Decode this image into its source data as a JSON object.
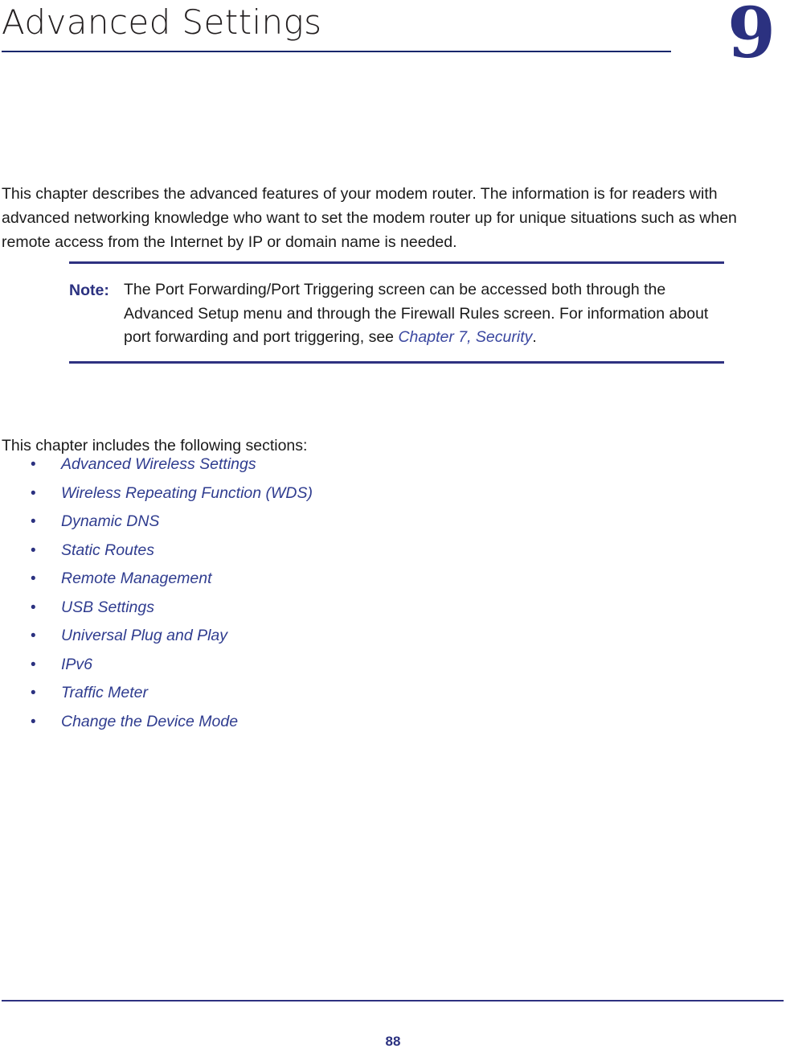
{
  "chapter": {
    "title": "Advanced Settings",
    "number": "9"
  },
  "intro": {
    "paragraph": "This chapter describes the advanced features of your modem router. The information is for readers with advanced networking knowledge who want to set the modem router up for unique situations such as when remote access from the Internet by IP or domain name is needed."
  },
  "note": {
    "label": "Note:",
    "text_before_link": "The Port Forwarding/Port Triggering screen can be accessed both through the Advanced Setup menu and through the Firewall Rules screen. For information about port forwarding and port triggering, see ",
    "link_text": "Chapter 7, Security",
    "text_after_link": "."
  },
  "sections": {
    "intro": "This chapter includes the following sections:",
    "bullet_glyph": "•",
    "items": [
      {
        "label": "Advanced Wireless Settings"
      },
      {
        "label": "Wireless Repeating Function (WDS)"
      },
      {
        "label": "Dynamic DNS"
      },
      {
        "label": "Static Routes"
      },
      {
        "label": "Remote Management"
      },
      {
        "label": "USB Settings"
      },
      {
        "label": "Universal Plug and Play"
      },
      {
        "label": "IPv6"
      },
      {
        "label": "Traffic Meter"
      },
      {
        "label": "Change the Device Mode"
      }
    ]
  },
  "footer": {
    "page_number": "88"
  },
  "colors": {
    "navy_rule": "#2e3180",
    "title_rule": "#16266b",
    "chapter_number": "#2b3180",
    "link": "#2f3c8f",
    "note_link": "#3a47a0",
    "title_text": "#231f20",
    "body_text": "#1a1a1a"
  }
}
